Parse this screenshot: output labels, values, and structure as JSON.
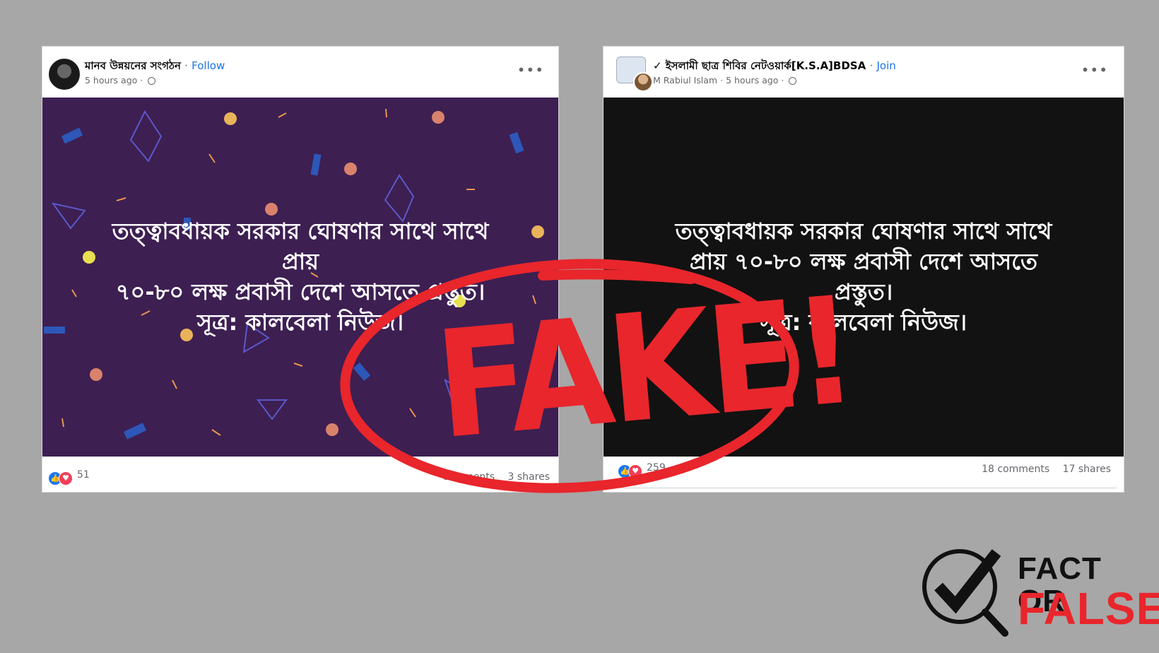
{
  "post1": {
    "page_name": "মানব উন্নয়নের সংগঠন",
    "follow_label": "Follow",
    "timestamp": "5 hours ago",
    "text_lines": [
      "তত্ত্বাবধায়ক সরকার ঘোষণার সাথে সাথে",
      "প্রায়",
      "৭০-৮০ লক্ষ প্রবাসী দেশে আসতে প্রস্তুত।",
      "সূত্র: কালবেলা নিউজ।"
    ],
    "reaction_count": "51",
    "comments": "comments",
    "shares": "3 shares",
    "background": "#3d1f52"
  },
  "post2": {
    "group_name": "✓ ইসলামী ছাত্র শিবির নেটওয়ার্ক[K.S.A]BDSA",
    "join_label": "Join",
    "author": "M Rabiul Islam",
    "timestamp": "5 hours ago",
    "text_lines": [
      "তত্ত্বাবধায়ক সরকার ঘোষণার সাথে সাথে",
      "প্রায় ৭০-৮০ লক্ষ প্রবাসী দেশে আসতে",
      "প্রস্তুত।",
      "সূত্র: কালবেলা নিউজ।"
    ],
    "reaction_count": "259",
    "comments": "18 comments",
    "shares": "17 shares",
    "background": "#121212"
  },
  "stamp": {
    "text": "FAKE!",
    "color": "#e8262c"
  },
  "logo": {
    "line1": "FACT OR",
    "line2": "FALSE"
  },
  "icons": {
    "more": "more-options-icon",
    "globe": "globe-icon",
    "like": "like-reaction-icon",
    "love": "love-reaction-icon"
  }
}
